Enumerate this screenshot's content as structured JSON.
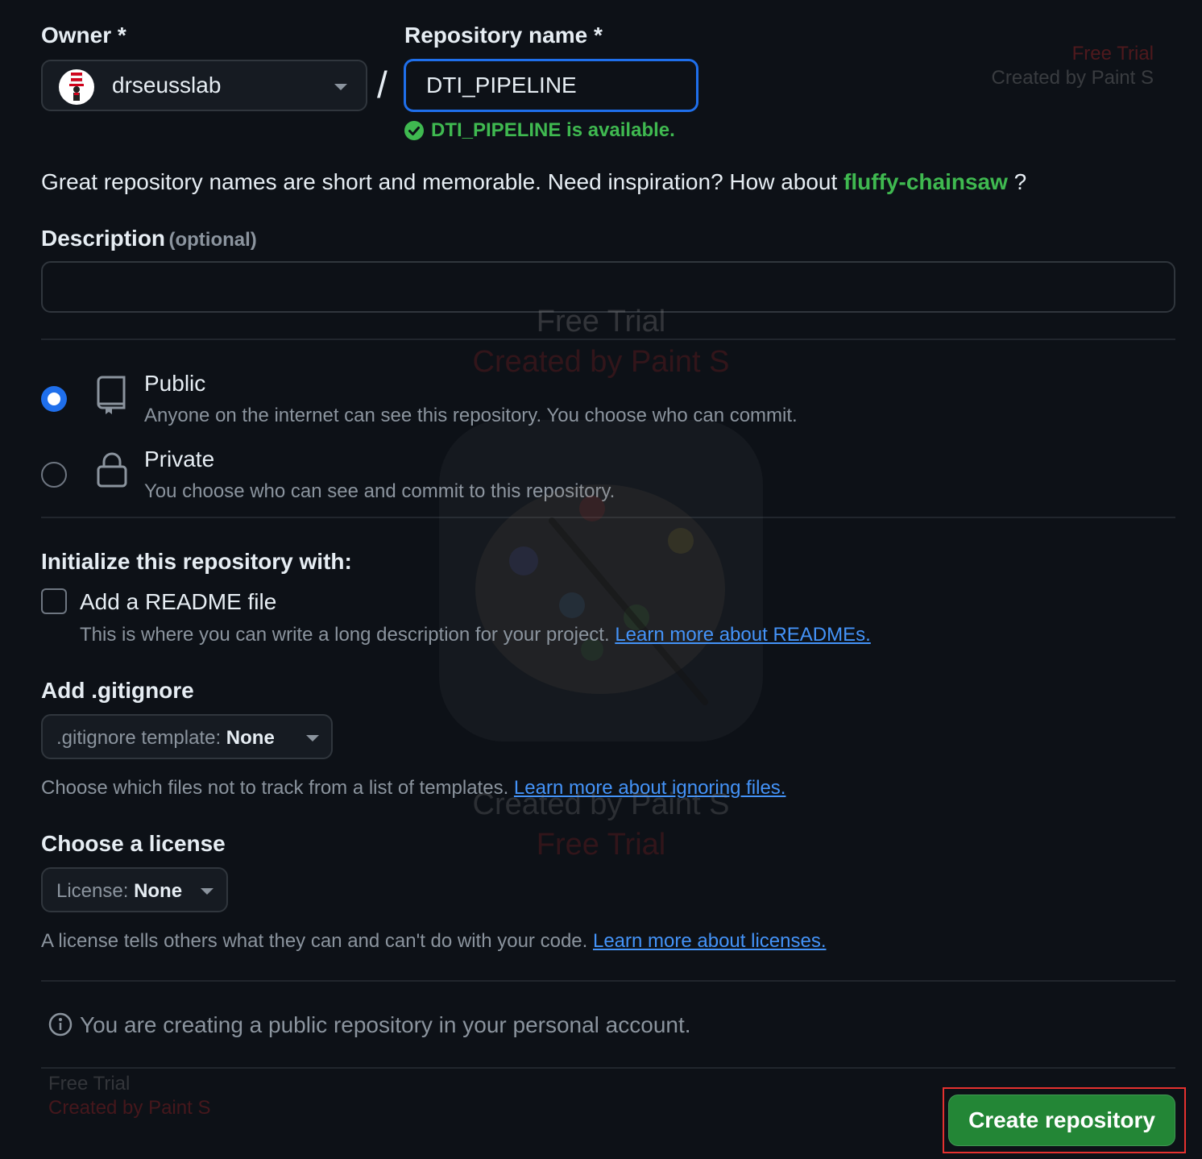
{
  "owner": {
    "label": "Owner",
    "required_mark": "*",
    "selected": "drseusslab"
  },
  "repo": {
    "label": "Repository name",
    "required_mark": "*",
    "separator": "/",
    "value": "DTI_PIPELINE",
    "availability": "DTI_PIPELINE is available."
  },
  "suggestion": {
    "text": "Great repository names are short and memorable. Need inspiration? How about",
    "name": "fluffy-chainsaw",
    "suffix": "?"
  },
  "description": {
    "label": "Description",
    "optional": "(optional)",
    "value": ""
  },
  "visibility": {
    "public": {
      "title": "Public",
      "desc": "Anyone on the internet can see this repository. You choose who can commit.",
      "selected": true
    },
    "private": {
      "title": "Private",
      "desc": "You choose who can see and commit to this repository.",
      "selected": false
    }
  },
  "init": {
    "heading": "Initialize this repository with:",
    "readme_label": "Add a README file",
    "readme_desc": "This is where you can write a long description for your project.",
    "readme_link": "Learn more about READMEs."
  },
  "gitignore": {
    "heading": "Add .gitignore",
    "select_prefix": ".gitignore template:",
    "select_value": "None",
    "help": "Choose which files not to track from a list of templates.",
    "help_link": "Learn more about ignoring files."
  },
  "license": {
    "heading": "Choose a license",
    "select_prefix": "License:",
    "select_value": "None",
    "help": "A license tells others what they can and can't do with your code.",
    "help_link": "Learn more about licenses."
  },
  "notice": "You are creating a public repository in your personal account.",
  "create_button": "Create repository",
  "watermark": {
    "line1": "Free Trial",
    "line2": "Created by Paint S"
  },
  "colors": {
    "background": "#0d1117",
    "accent_blue": "#1f6feb",
    "success_green": "#3fb950",
    "button_green": "#238636",
    "link_blue": "#4493f8",
    "highlight_red": "#e5312f"
  }
}
